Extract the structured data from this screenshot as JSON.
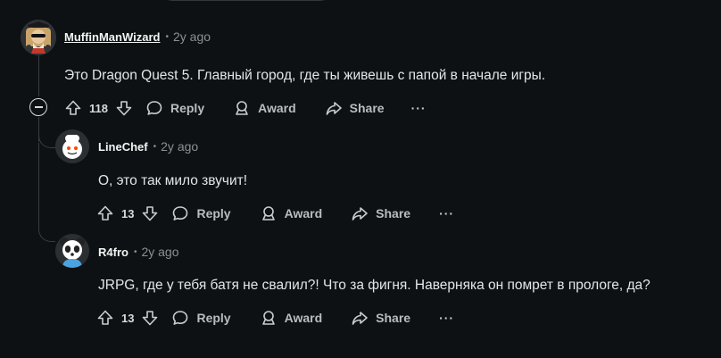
{
  "comments": [
    {
      "author": "MuffinManWizard",
      "time": "2y ago",
      "text": "Это Dragon Quest 5. Главный город, где ты живешь с папой в начале игры.",
      "votes": "118",
      "reply_label": "Reply",
      "award_label": "Award",
      "share_label": "Share",
      "more_label": "···"
    },
    {
      "author": "LineChef",
      "time": "2y ago",
      "text": "О, это так мило звучит!",
      "votes": "13",
      "reply_label": "Reply",
      "award_label": "Award",
      "share_label": "Share",
      "more_label": "···"
    },
    {
      "author": "R4fro",
      "time": "2y ago",
      "text": "JRPG, где у тебя батя не свалил?! Что за фигня. Наверняка он помрет в прологе, да?",
      "votes": "13",
      "reply_label": "Reply",
      "award_label": "Award",
      "share_label": "Share",
      "more_label": "···"
    }
  ],
  "separator": "•",
  "colors": {
    "background": "#0e1113",
    "text": "#d7dadc",
    "muted": "#8c9092",
    "thread_line": "#3a3d40"
  }
}
